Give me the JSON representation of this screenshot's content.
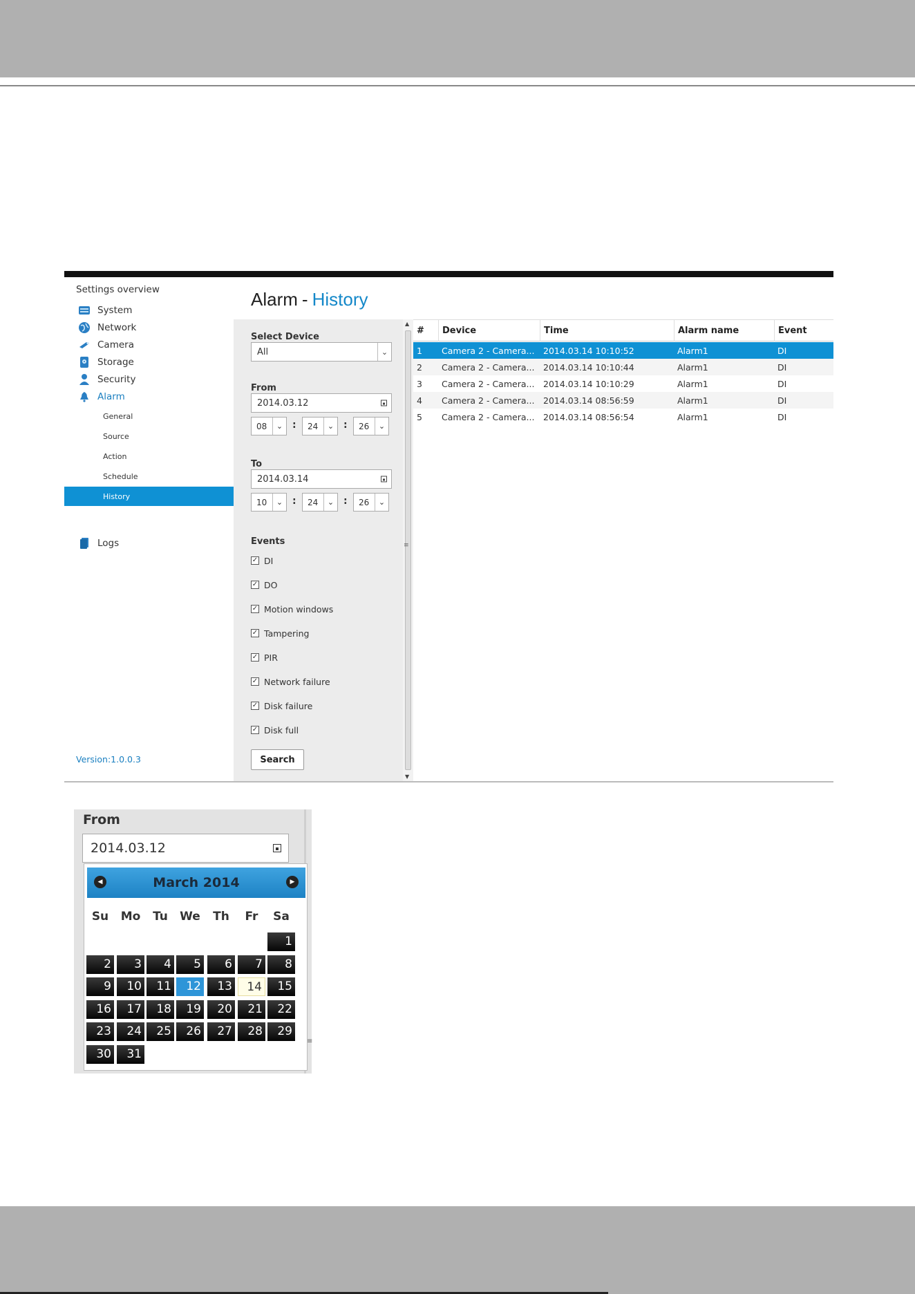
{
  "sidebar": {
    "overview": "Settings overview",
    "items": [
      {
        "label": "System",
        "icon": "system-icon"
      },
      {
        "label": "Network",
        "icon": "globe-icon"
      },
      {
        "label": "Camera",
        "icon": "camera-icon"
      },
      {
        "label": "Storage",
        "icon": "storage-icon"
      },
      {
        "label": "Security",
        "icon": "user-icon"
      },
      {
        "label": "Alarm",
        "icon": "bell-icon"
      }
    ],
    "subitems": [
      "General",
      "Source",
      "Action",
      "Schedule",
      "History"
    ],
    "logs": "Logs",
    "version": "Version:1.0.0.3"
  },
  "title": {
    "main": "Alarm",
    "dash": "-",
    "sub": "History"
  },
  "filter": {
    "select_device_label": "Select Device",
    "device_value": "All",
    "from_label": "From",
    "from_date": "2014.03.12",
    "from_h": "08",
    "from_m": "24",
    "from_s": "26",
    "to_label": "To",
    "to_date": "2014.03.14",
    "to_h": "10",
    "to_m": "24",
    "to_s": "26",
    "colon": ":",
    "events_label": "Events",
    "events": [
      "DI",
      "DO",
      "Motion windows",
      "Tampering",
      "PIR",
      "Network failure",
      "Disk failure",
      "Disk full"
    ],
    "check_mark": "✓",
    "search_label": "Search"
  },
  "table": {
    "headers": [
      "#",
      "Device",
      "Time",
      "Alarm name",
      "Event"
    ],
    "rows": [
      [
        "1",
        "Camera 2 - Camera...",
        "2014.03.14 10:10:52",
        "Alarm1",
        "DI"
      ],
      [
        "2",
        "Camera 2 - Camera...",
        "2014.03.14 10:10:44",
        "Alarm1",
        "DI"
      ],
      [
        "3",
        "Camera 2 - Camera...",
        "2014.03.14 10:10:29",
        "Alarm1",
        "DI"
      ],
      [
        "4",
        "Camera 2 - Camera...",
        "2014.03.14 08:56:59",
        "Alarm1",
        "DI"
      ],
      [
        "5",
        "Camera 2 - Camera...",
        "2014.03.14 08:56:54",
        "Alarm1",
        "DI"
      ]
    ],
    "selected_row": 1
  },
  "calendar": {
    "from_label": "From",
    "date_value": "2014.03.12",
    "month_title": "March 2014",
    "weekdays": [
      "Su",
      "Mo",
      "Tu",
      "We",
      "Th",
      "Fr",
      "Sa"
    ],
    "days": [
      "1",
      "2",
      "3",
      "4",
      "5",
      "6",
      "7",
      "8",
      "9",
      "10",
      "11",
      "12",
      "13",
      "14",
      "15",
      "16",
      "17",
      "18",
      "19",
      "20",
      "21",
      "22",
      "23",
      "24",
      "25",
      "26",
      "27",
      "28",
      "29",
      "30",
      "31"
    ],
    "selected_day": "12",
    "today_day": "14",
    "prev_icon": "◀",
    "next_icon": "▶"
  },
  "colors": {
    "accent": "#0f91d4",
    "title_accent": "#1488c9",
    "band": "#b0b0b0"
  }
}
